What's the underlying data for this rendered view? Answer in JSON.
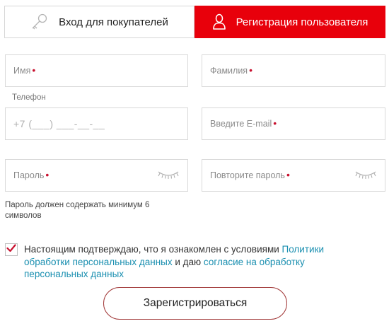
{
  "tabs": {
    "login_label": "Вход для покупателей",
    "register_label": "Регистрация пользователя",
    "active_color": "#e8000b"
  },
  "form": {
    "first_name_placeholder": "Имя",
    "last_name_placeholder": "Фамилия",
    "phone_label": "Телефон",
    "phone_mask": "+7 (___) ___-__-__",
    "email_placeholder": "Введите E-mail",
    "password_placeholder": "Пароль",
    "password_repeat_placeholder": "Повторите пароль",
    "required_marker": "•",
    "password_hint": "Пароль должен содержать минимум 6 символов"
  },
  "consent": {
    "checked": true,
    "text_before": "Настоящим подтверждаю, что я ознакомлен с условиями ",
    "link_policy": "Политики обработки персональных данных",
    "text_middle": " и даю ",
    "link_consent": "согласие на обработку персональных данных"
  },
  "submit_label": "Зарегистрироваться",
  "icons": {
    "login_tab": "key-icon",
    "register_tab": "user-icon",
    "password": "eye-closed-icon",
    "checkbox": "checkmark-icon"
  },
  "colors": {
    "brand_red": "#e8000b",
    "link": "#1a8fb0",
    "button_border": "#a23a3a"
  }
}
